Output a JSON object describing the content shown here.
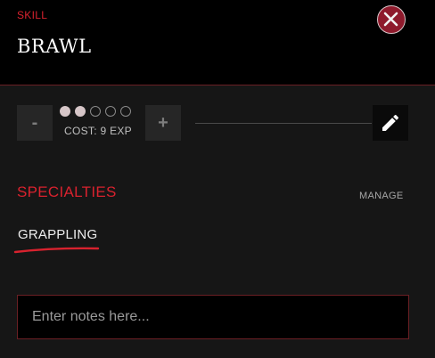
{
  "header": {
    "eyebrow": "SKILL",
    "title": "BRAWL"
  },
  "rating": {
    "decrement_label": "-",
    "increment_label": "+",
    "value": 2,
    "max": 5,
    "cost_text": "COST: 9 EXP"
  },
  "specialties": {
    "heading": "SPECIALTIES",
    "manage_label": "MANAGE",
    "items": [
      {
        "label": "GRAPPLING"
      }
    ]
  },
  "notes": {
    "placeholder": "Enter notes here...",
    "value": ""
  },
  "icons": {
    "close": "close-icon",
    "edit": "pencil-icon"
  },
  "colors": {
    "accent": "#d8222e",
    "close_button": "#8e1a2c",
    "border": "#6a1f24",
    "background": "#161616",
    "header_background": "#000000"
  }
}
